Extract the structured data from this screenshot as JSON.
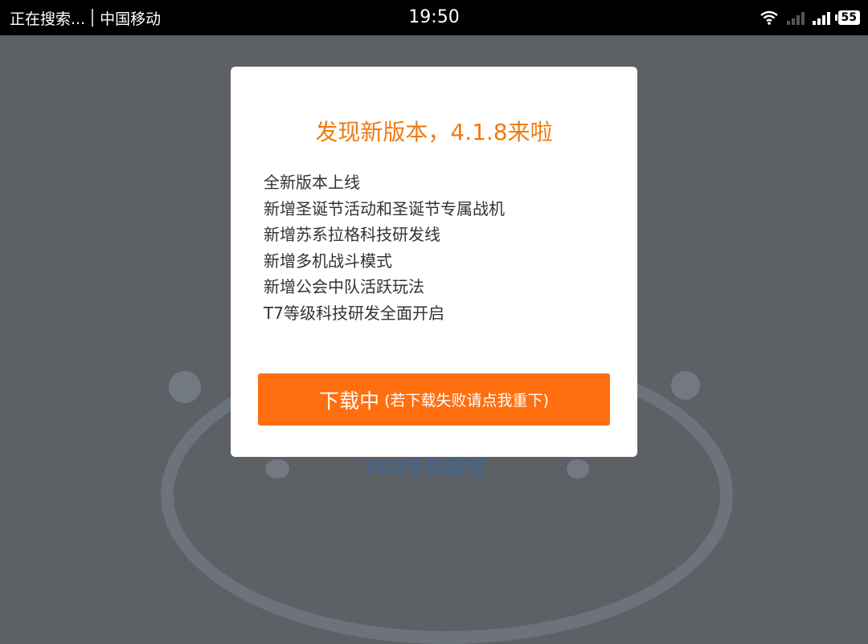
{
  "status_bar": {
    "left_text": "正在搜索...",
    "carrier": "中国移动",
    "time": "19:50",
    "battery": "55"
  },
  "background": {
    "logo_text": "360手机游戏"
  },
  "dialog": {
    "title": "发现新版本，4.1.8来啦",
    "notes": [
      "全新版本上线",
      "新增圣诞节活动和圣诞节专属战机",
      "新增苏系拉格科技研发线",
      "新增多机战斗模式",
      "新增公会中队活跃玩法",
      "T7等级科技研发全面开启"
    ],
    "button_label": "下载中",
    "button_sub_label": "(若下载失败请点我重下)"
  },
  "colors": {
    "accent": "#f07a10",
    "button": "#ff6f10",
    "overlay": "#5d6166"
  }
}
